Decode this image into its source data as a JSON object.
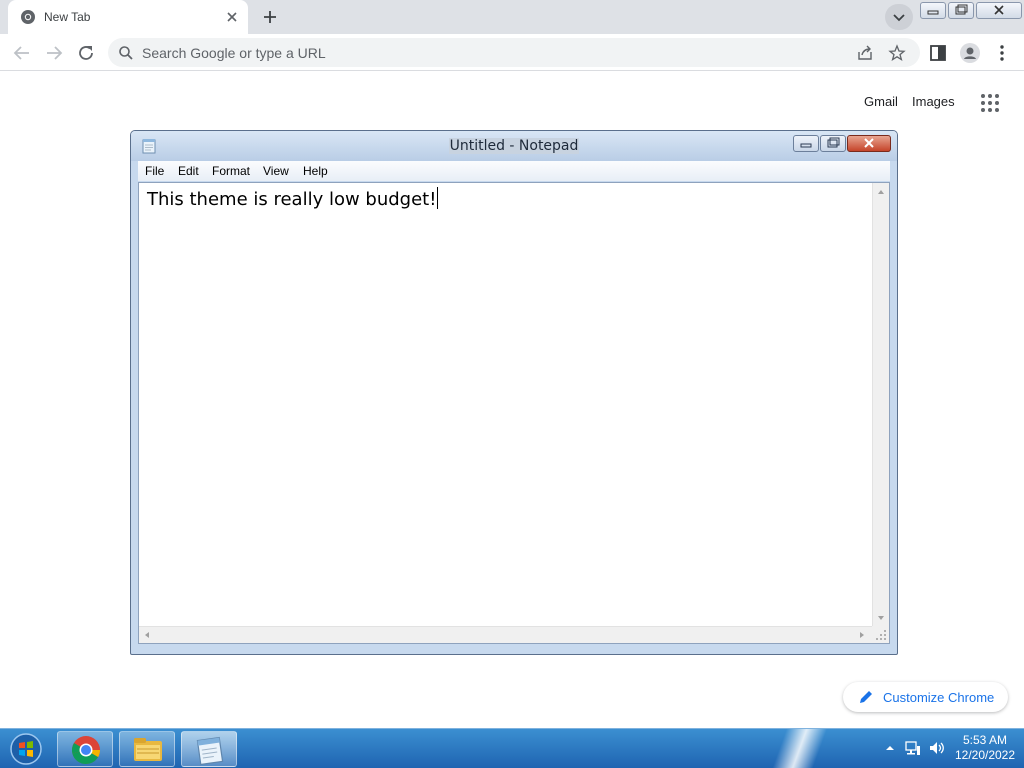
{
  "browser": {
    "tab_title": "New Tab",
    "omnibox_placeholder": "Search Google or type a URL"
  },
  "ntp": {
    "links": [
      "Gmail",
      "Images"
    ],
    "customize_label": "Customize Chrome"
  },
  "notepad": {
    "title": "Untitled - Notepad",
    "menus": [
      "File",
      "Edit",
      "Format",
      "View",
      "Help"
    ],
    "content": "This theme is really low budget!"
  },
  "taskbar": {
    "time": "5:53 AM",
    "date": "12/20/2022",
    "pinned": [
      "chrome-icon",
      "file-explorer-icon",
      "notepad-icon"
    ]
  },
  "colors": {
    "link_blue": "#1a73e8",
    "taskbar_blue": "#2a78c6",
    "notepad_frame": "#c7d9ee"
  }
}
